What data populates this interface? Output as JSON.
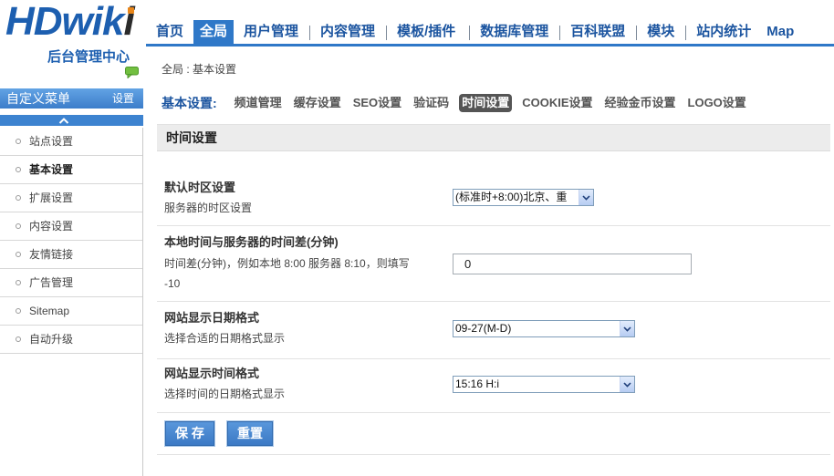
{
  "logo": {
    "main": "HDwik",
    "accent": "i",
    "subtitle": "后台管理中心"
  },
  "topnav": {
    "items": [
      {
        "label": "首页"
      },
      {
        "label": "全局",
        "active": true
      },
      {
        "label": "用户管理"
      },
      {
        "label": "内容管理"
      },
      {
        "label": "模板/插件"
      },
      {
        "label": "数据库管理"
      },
      {
        "label": "百科联盟"
      },
      {
        "label": "模块"
      },
      {
        "label": "站内统计"
      },
      {
        "label": "Map"
      }
    ]
  },
  "sidebar": {
    "title": "自定义菜单",
    "settings_label": "设置",
    "items": [
      {
        "label": "站点设置"
      },
      {
        "label": "基本设置",
        "active": true
      },
      {
        "label": "扩展设置"
      },
      {
        "label": "内容设置"
      },
      {
        "label": "友情链接"
      },
      {
        "label": "广告管理"
      },
      {
        "label": "Sitemap"
      },
      {
        "label": "自动升级"
      }
    ]
  },
  "breadcrumb": "全局 : 基本设置",
  "subnav": {
    "title": "基本设置:",
    "items": [
      {
        "label": "频道管理"
      },
      {
        "label": "缓存设置"
      },
      {
        "label": "SEO设置"
      },
      {
        "label": "验证码"
      },
      {
        "label": "时间设置",
        "active": true
      },
      {
        "label": "COOKIE设置"
      },
      {
        "label": "经验金币设置"
      },
      {
        "label": "LOGO设置"
      }
    ]
  },
  "section": {
    "title": "时间设置"
  },
  "form": {
    "rows": [
      {
        "label": "默认时区设置",
        "description": "服务器的时区设置",
        "value": "(标准时+8:00)北京、重"
      },
      {
        "label": "本地时间与服务器的时间差(分钟)",
        "description": "时间差(分钟)，例如本地 8:00 服务器 8:10，则填写 -10",
        "value": "0"
      },
      {
        "label": "网站显示日期格式",
        "description": "选择合适的日期格式显示",
        "value": "09-27(M-D)"
      },
      {
        "label": "网站显示时间格式",
        "description": "选择时间的日期格式显示",
        "value": "15:16 H:i"
      }
    ],
    "buttons": {
      "save": "保 存",
      "reset": "重置"
    }
  },
  "icons": {
    "sidebar_toggle": "chevron-up-icon",
    "menu_bullet": "circle-bullet-icon",
    "select_arrow": "chevron-down-icon",
    "logo_badge": "chat-bubble-icon"
  },
  "colors": {
    "brand": "#1d5fb0",
    "nav_text": "#1c55a0",
    "nav_active": "#2f78c8",
    "bar_blue": "#3d83d0",
    "subnav_active": "#555555",
    "section_bg": "#ececec",
    "chat_green": "#72bf40",
    "logo_accent": "#e8861a"
  }
}
